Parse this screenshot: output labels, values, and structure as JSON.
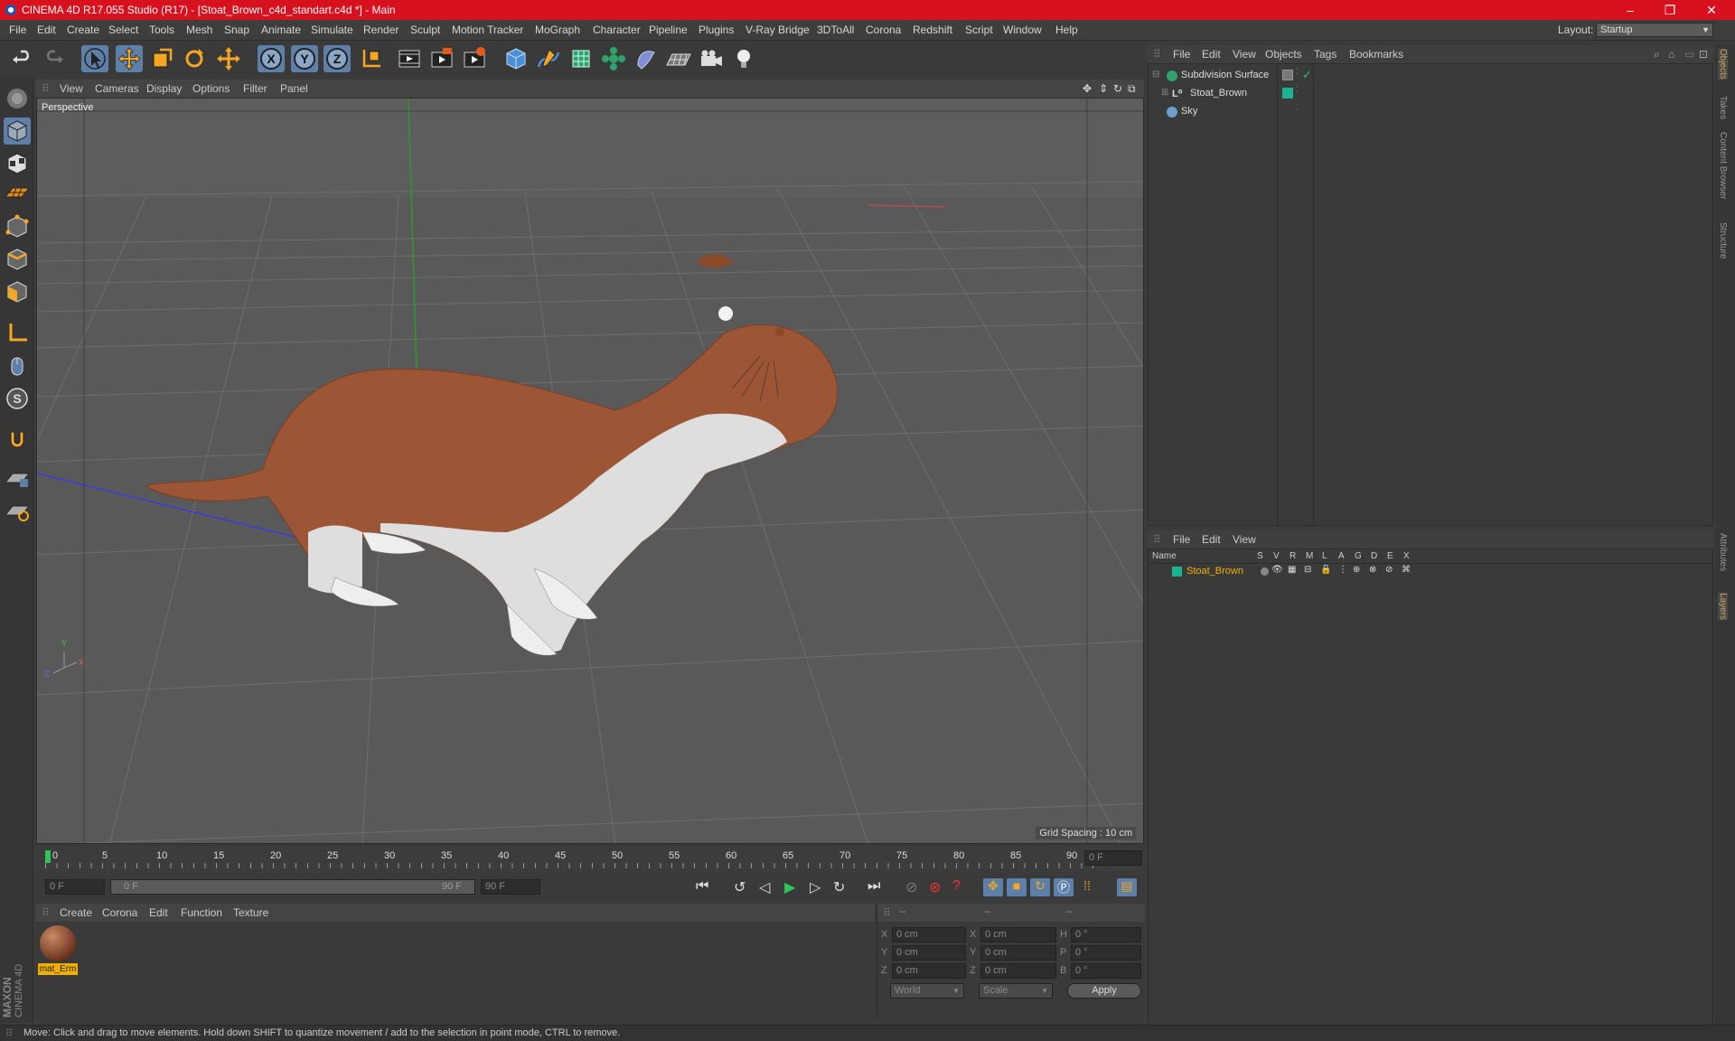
{
  "window": {
    "title": "CINEMA 4D R17.055 Studio (R17) - [Stoat_Brown_c4d_standart.c4d *] - Main",
    "controls": [
      "–",
      "❐",
      "✕"
    ]
  },
  "menubar": {
    "items": [
      "File",
      "Edit",
      "Create",
      "Select",
      "Tools",
      "Mesh",
      "Snap",
      "Animate",
      "Simulate",
      "Render",
      "Sculpt",
      "Motion Tracker",
      "MoGraph",
      "Character",
      "Pipeline",
      "Plugins",
      "V-Ray Bridge",
      "3DToAll",
      "Corona",
      "Redshift",
      "Script",
      "Window",
      "Help"
    ],
    "layout_label": "Layout:",
    "layout_value": "Startup"
  },
  "toolbar": {
    "icons": [
      "undo-icon",
      "redo-icon",
      "select-arrow-icon",
      "move-icon",
      "scale-icon",
      "rotate-icon",
      "transform-icon",
      "x-axis-icon",
      "y-axis-icon",
      "z-axis-icon",
      "coordinate-system-icon",
      "render-view-icon",
      "render-picture-viewer-icon",
      "render-settings-icon",
      "cube-icon",
      "pen-spline-icon",
      "subdivision-icon",
      "cloner-icon",
      "deformer-icon",
      "floor-icon",
      "camera-icon",
      "light-icon"
    ],
    "axis_labels": [
      "X",
      "Y",
      "Z"
    ]
  },
  "viewport": {
    "menu": [
      "View",
      "Cameras",
      "Display",
      "Options",
      "Filter",
      "Panel"
    ],
    "camera_label": "Perspective",
    "grid_spacing": "Grid Spacing : 10 cm",
    "axis_labels": {
      "y": "Y",
      "z": "Z",
      "x": "X"
    }
  },
  "timeline": {
    "ticks": [
      "0",
      "5",
      "10",
      "15",
      "20",
      "25",
      "30",
      "35",
      "40",
      "45",
      "50",
      "55",
      "60",
      "65",
      "70",
      "75",
      "80",
      "85",
      "90"
    ],
    "current_frame": "0 F",
    "start_field": "0 F",
    "slider_start": "0 F",
    "slider_end": "90 F",
    "end_field": "90 F"
  },
  "material_panel": {
    "menu": [
      "Create",
      "Corona",
      "Edit",
      "Function",
      "Texture"
    ],
    "materials": [
      {
        "name": "mat_Erm"
      }
    ]
  },
  "coordinates": {
    "headers": [
      "--",
      "--",
      "--"
    ],
    "rows": [
      {
        "a": "X",
        "av": "0 cm",
        "b": "X",
        "bv": "0 cm",
        "c": "H",
        "cv": "0 °"
      },
      {
        "a": "Y",
        "av": "0 cm",
        "b": "Y",
        "bv": "0 cm",
        "c": "P",
        "cv": "0 °"
      },
      {
        "a": "Z",
        "av": "0 cm",
        "b": "Z",
        "bv": "0 cm",
        "c": "B",
        "cv": "0 °"
      }
    ],
    "mode1": "World",
    "mode2": "Scale",
    "apply": "Apply"
  },
  "object_manager": {
    "menu": [
      "File",
      "Edit",
      "View",
      "Objects",
      "Tags",
      "Bookmarks"
    ],
    "objects": [
      {
        "name": "Subdivision Surface",
        "color": "#3aa0e6"
      },
      {
        "name": "Stoat_Brown",
        "color": "#19b394"
      },
      {
        "name": "Sky",
        "color": "#6ea0cf"
      }
    ]
  },
  "layer_manager": {
    "menu": [
      "File",
      "Edit",
      "View"
    ],
    "columns": [
      "Name",
      "S",
      "V",
      "R",
      "M",
      "L",
      "A",
      "G",
      "D",
      "E",
      "X"
    ],
    "layers": [
      {
        "name": "Stoat_Brown",
        "color": "#19b394"
      }
    ]
  },
  "side_tabs": [
    "Objects",
    "Takes",
    "Content Browser",
    "Structure",
    "Attributes",
    "Layers"
  ],
  "brand": {
    "line1": "MAXON",
    "line2": "CINEMA 4D"
  },
  "status": "Move: Click and drag to move elements. Hold down SHIFT to quantize movement / add to the selection in point mode, CTRL to remove.",
  "colors": {
    "titlebar": "#d7111d",
    "accent": "#5e7fa8",
    "highlight": "#f0b000"
  }
}
